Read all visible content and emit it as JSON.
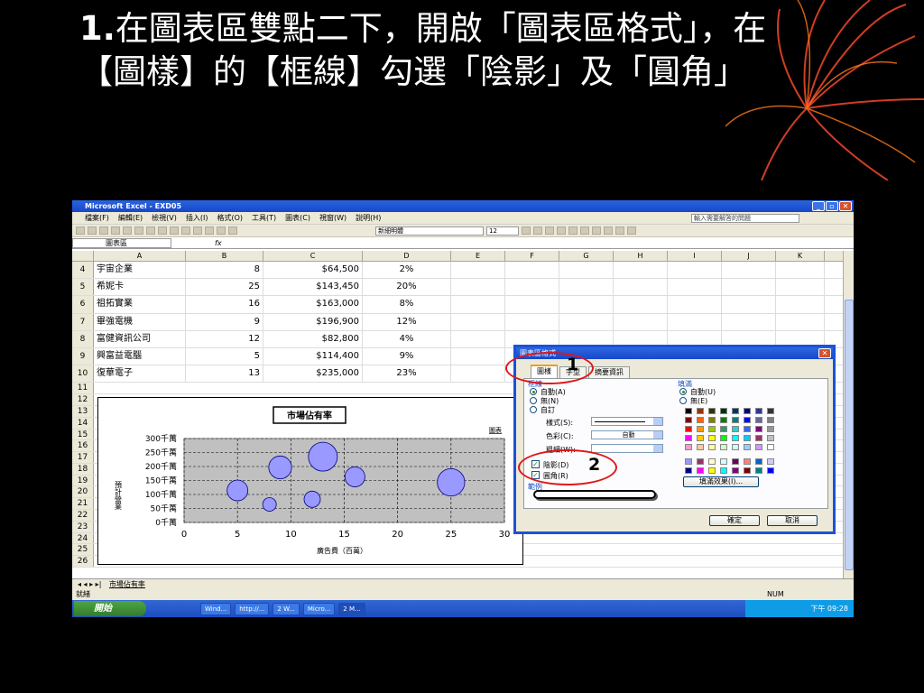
{
  "slide": {
    "title_num": "1.",
    "title_text": "在圖表區雙點二下，開啟「圖表區格式」，在【圖樣】的【框線】勾選「陰影」及「圓角」"
  },
  "excel": {
    "window_title": "Microsoft Excel - EXD05",
    "menus": [
      "檔案(F)",
      "編輯(E)",
      "檢視(V)",
      "插入(I)",
      "格式(O)",
      "工具(T)",
      "圖表(C)",
      "視窗(W)",
      "說明(H)"
    ],
    "help_placeholder": "輸入需要解答的問題",
    "font_name": "新細明體",
    "font_size": "12",
    "name_box": "圖表區",
    "fx": "fx",
    "columns": [
      "A",
      "B",
      "C",
      "D",
      "E",
      "F",
      "G",
      "H",
      "I",
      "J",
      "K"
    ],
    "rows": [
      {
        "n": "4",
        "a": "宇宙企業",
        "b": "8",
        "c": "$64,500",
        "d": "2%"
      },
      {
        "n": "5",
        "a": "希妮卡",
        "b": "25",
        "c": "$143,450",
        "d": "20%"
      },
      {
        "n": "6",
        "a": "祖拓實業",
        "b": "16",
        "c": "$163,000",
        "d": "8%"
      },
      {
        "n": "7",
        "a": "畢強電機",
        "b": "9",
        "c": "$196,900",
        "d": "12%"
      },
      {
        "n": "8",
        "a": "富健資訊公司",
        "b": "12",
        "c": "$82,800",
        "d": "4%"
      },
      {
        "n": "9",
        "a": "興富益電腦",
        "b": "5",
        "c": "$114,400",
        "d": "9%"
      },
      {
        "n": "10",
        "a": "復華電子",
        "b": "13",
        "c": "$235,000",
        "d": "23%"
      }
    ],
    "empty_rows": [
      "11",
      "12",
      "13",
      "14",
      "15",
      "16",
      "17",
      "18",
      "19",
      "20",
      "21",
      "22",
      "23",
      "24",
      "25",
      "26"
    ],
    "sheet_tab": "市場佔有率",
    "status_left": "就緒",
    "status_right": "NUM",
    "taskbar": {
      "start": "開始",
      "tasks": [
        "Wind...",
        "http://...",
        "2 W...",
        "Micro...",
        "2 M..."
      ],
      "clock": "下午 09:28"
    }
  },
  "chart": {
    "title": "市場佔有率",
    "legend": "圖表",
    "ylabel": "預計營業",
    "xlabel": "廣告費（百萬）",
    "y_ticks": [
      "0千萬",
      "50千萬",
      "100千萬",
      "150千萬",
      "200千萬",
      "250千萬",
      "300千萬"
    ],
    "x_ticks": [
      "0",
      "5",
      "10",
      "15",
      "20",
      "25",
      "30"
    ]
  },
  "chart_data": {
    "type": "scatter",
    "title": "市場佔有率",
    "xlabel": "廣告費（百萬）",
    "ylabel": "預計營業",
    "xlim": [
      0,
      30
    ],
    "ylim": [
      0,
      300
    ],
    "points": [
      {
        "x": 8,
        "y": 64.5,
        "size": 2
      },
      {
        "x": 25,
        "y": 143.45,
        "size": 20
      },
      {
        "x": 16,
        "y": 163,
        "size": 8
      },
      {
        "x": 9,
        "y": 196.9,
        "size": 12
      },
      {
        "x": 12,
        "y": 82.8,
        "size": 4
      },
      {
        "x": 5,
        "y": 114.4,
        "size": 9
      },
      {
        "x": 13,
        "y": 235,
        "size": 23
      }
    ],
    "bubble_color": "#9999ff",
    "grid": true
  },
  "dialog": {
    "title": "圖表區格式",
    "tabs": [
      "圖樣",
      "字型",
      "摘要資訊"
    ],
    "border_group": "框線",
    "border_auto": "自動(A)",
    "border_none": "無(N)",
    "border_custom": "自訂",
    "style_label": "樣式(S):",
    "color_label": "色彩(C):",
    "color_value": "自動",
    "weight_label": "粗細(W):",
    "shadow_label": "陰影(D)",
    "round_label": "圓角(R)",
    "sample_label": "範例",
    "fill_group": "填滿",
    "fill_auto": "自動(U)",
    "fill_none": "無(E)",
    "fill_effects": "填滿效果(I)...",
    "ok": "確定",
    "cancel": "取消",
    "swatches": [
      [
        "#000000",
        "#993300",
        "#333300",
        "#003300",
        "#003366",
        "#000080",
        "#333399",
        "#333333"
      ],
      [
        "#800000",
        "#ff6600",
        "#808000",
        "#008000",
        "#008080",
        "#0000ff",
        "#666699",
        "#808080"
      ],
      [
        "#ff0000",
        "#ff9900",
        "#99cc00",
        "#339966",
        "#33cccc",
        "#3366ff",
        "#800080",
        "#969696"
      ],
      [
        "#ff00ff",
        "#ffcc00",
        "#ffff00",
        "#00ff00",
        "#00ffff",
        "#00ccff",
        "#993366",
        "#c0c0c0"
      ],
      [
        "#ff99cc",
        "#ffcc99",
        "#ffff99",
        "#ccffcc",
        "#ccffff",
        "#99ccff",
        "#cc99ff",
        "#ffffff"
      ],
      [
        "#9999ff",
        "#993366",
        "#ffffcc",
        "#ccffff",
        "#660066",
        "#ff8080",
        "#0066cc",
        "#ccccff"
      ],
      [
        "#000080",
        "#ff00ff",
        "#ffff00",
        "#00ffff",
        "#800080",
        "#800000",
        "#008080",
        "#0000ff"
      ]
    ]
  },
  "callouts": {
    "one": "1",
    "two": "2"
  }
}
